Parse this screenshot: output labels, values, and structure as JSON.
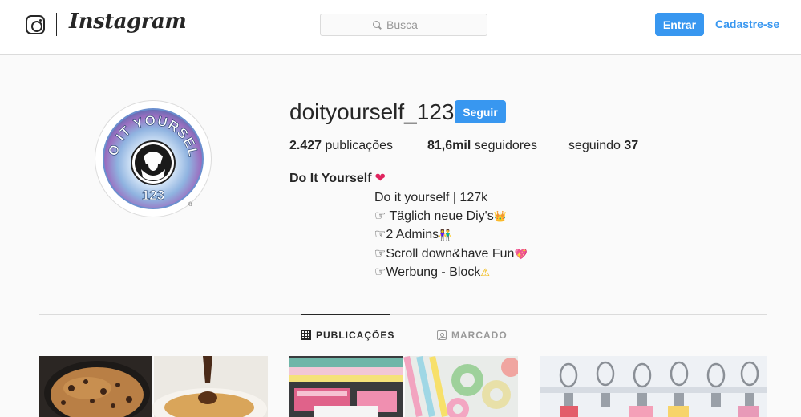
{
  "nav": {
    "logo_text": "Instagram",
    "search_placeholder": "Busca",
    "login_label": "Entrar",
    "signup_label": "Cadastre-se"
  },
  "profile": {
    "username": "doityourself_123",
    "follow_label": "Seguir",
    "avatar_text": "DO IT YOURSELF 123",
    "stats": {
      "posts_count": "2.427",
      "posts_label": "publicações",
      "followers_count": "81,6mil",
      "followers_label": "seguidores",
      "following_label": "seguindo",
      "following_count": "37"
    },
    "bio": {
      "name": "Do It Yourself",
      "lines": [
        "Do it yourself | 127k",
        "☞ Täglich neue Diy's",
        "☞2 Admins",
        "☞Scroll down&have Fun",
        "☞Werbung - Block"
      ]
    }
  },
  "tabs": [
    {
      "label": "PUBLICAÇÕES",
      "icon": "grid-icon",
      "active": true
    },
    {
      "label": "MARCADO",
      "icon": "tagged-icon",
      "active": false
    }
  ],
  "colors": {
    "accent": "#3897f0",
    "text": "#262626",
    "muted": "#999999",
    "border": "#dbdbdb",
    "background": "#fafafa"
  },
  "posts": [
    {
      "name": "post-thumbnail-cookie-skillet"
    },
    {
      "name": "post-thumbnail-washi-tape"
    },
    {
      "name": "post-thumbnail-clip-hangers"
    }
  ]
}
